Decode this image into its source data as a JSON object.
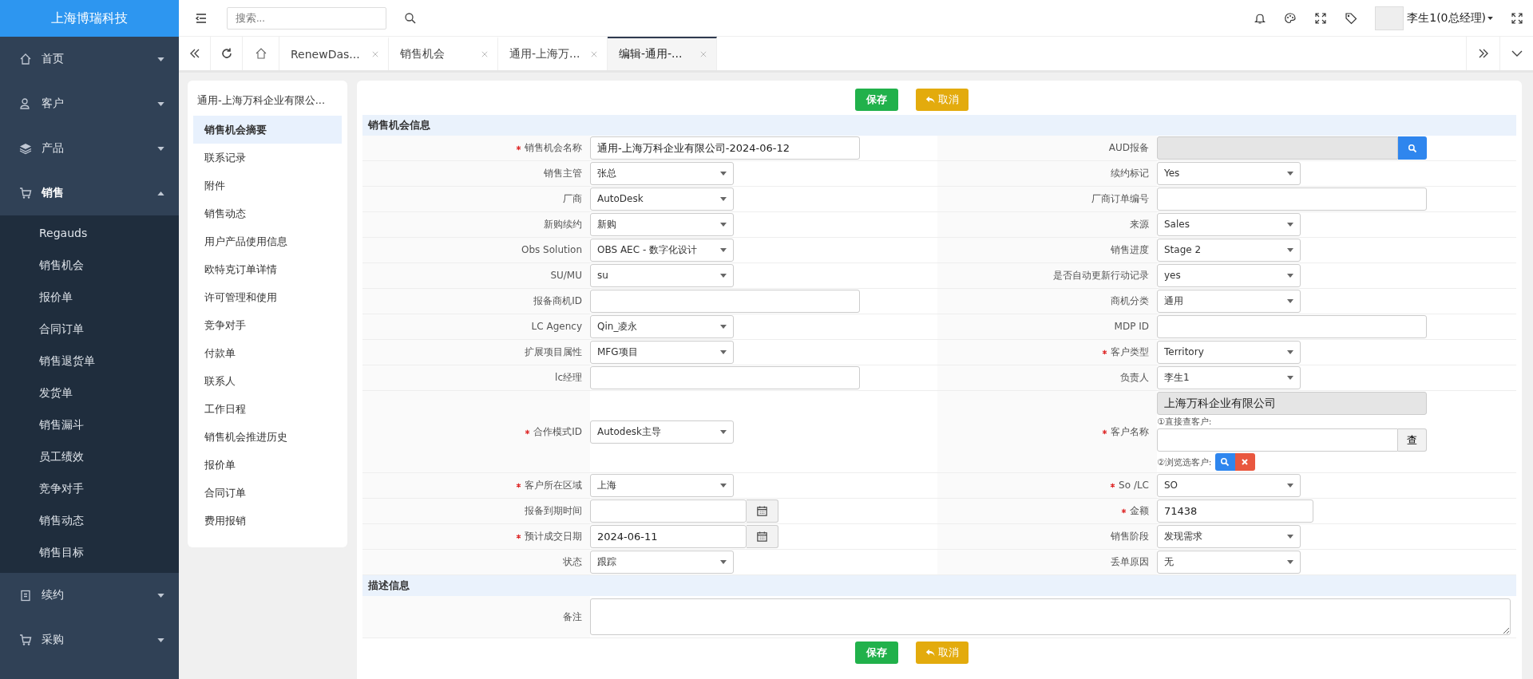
{
  "logo": "上海博瑞科技",
  "sidebar": {
    "items": [
      {
        "label": "首页",
        "expanded": false
      },
      {
        "label": "客户",
        "expanded": false
      },
      {
        "label": "产品",
        "expanded": false
      },
      {
        "label": "销售",
        "expanded": true,
        "children": [
          {
            "label": "Regauds"
          },
          {
            "label": "销售机会"
          },
          {
            "label": "报价单"
          },
          {
            "label": "合同订单"
          },
          {
            "label": "销售退货单"
          },
          {
            "label": "发货单"
          },
          {
            "label": "销售漏斗"
          },
          {
            "label": "员工绩效"
          },
          {
            "label": "竞争对手"
          },
          {
            "label": "销售动态"
          },
          {
            "label": "销售目标"
          }
        ]
      },
      {
        "label": "续约",
        "expanded": false
      },
      {
        "label": "采购",
        "expanded": false
      }
    ]
  },
  "topbar": {
    "search": {
      "placeholder": "搜索..."
    },
    "user": "李生1(0总经理)"
  },
  "tabs": [
    {
      "label": "RenewDas...",
      "selected": false
    },
    {
      "label": "销售机会",
      "selected": false
    },
    {
      "label": "通用-上海万...",
      "selected": false
    },
    {
      "label": "编辑-通用-...",
      "selected": true
    }
  ],
  "record_menu": {
    "title": "通用-上海万科企业有限公...",
    "items": [
      {
        "label": "销售机会摘要",
        "selected": true
      },
      {
        "label": "联系记录",
        "selected": false
      },
      {
        "label": "附件",
        "selected": false
      },
      {
        "label": "销售动态",
        "selected": false
      },
      {
        "label": "用户产品使用信息",
        "selected": false
      },
      {
        "label": "欧特克订单详情",
        "selected": false
      },
      {
        "label": "许可管理和使用",
        "selected": false
      },
      {
        "label": "竞争对手",
        "selected": false
      },
      {
        "label": "付款单",
        "selected": false
      },
      {
        "label": "联系人",
        "selected": false
      },
      {
        "label": "工作日程",
        "selected": false
      },
      {
        "label": "销售机会推进历史",
        "selected": false
      },
      {
        "label": "报价单",
        "selected": false
      },
      {
        "label": "合同订单",
        "selected": false
      },
      {
        "label": "费用报销",
        "selected": false
      }
    ]
  },
  "buttons_top": {
    "save": "保存",
    "cancel": "取消"
  },
  "buttons_bottom": {
    "save": "保存",
    "cancel": "取消"
  },
  "sections": [
    {
      "title": "销售机会信息",
      "rows": [
        [
          {
            "label": "销售机会名称",
            "required": true,
            "kind": "text",
            "value": "通用-上海万科企业有限公司-2024-06-12"
          },
          {
            "label": "AUD报备",
            "required": false,
            "kind": "lookup"
          }
        ],
        [
          {
            "label": "销售主管",
            "required": false,
            "kind": "select",
            "value": "张总"
          },
          {
            "label": "续约标记",
            "required": false,
            "kind": "select",
            "value": "Yes"
          }
        ],
        [
          {
            "label": "厂商",
            "required": false,
            "kind": "select",
            "value": "AutoDesk"
          },
          {
            "label": "厂商订单编号",
            "required": false,
            "kind": "text"
          }
        ],
        [
          {
            "label": "新购续约",
            "required": false,
            "kind": "select",
            "value": "新购"
          },
          {
            "label": "来源",
            "required": false,
            "kind": "select",
            "value": "Sales"
          }
        ],
        [
          {
            "label": "Obs Solution",
            "required": false,
            "kind": "select",
            "value": "OBS AEC - 数字化设计"
          },
          {
            "label": "销售进度",
            "required": false,
            "kind": "select",
            "value": "Stage 2"
          }
        ],
        [
          {
            "label": "SU/MU",
            "required": false,
            "kind": "select",
            "value": "su"
          },
          {
            "label": "是否自动更新行动记录",
            "required": false,
            "kind": "select",
            "value": "yes"
          }
        ],
        [
          {
            "label": "报备商机ID",
            "required": false,
            "kind": "text"
          },
          {
            "label": "商机分类",
            "required": false,
            "kind": "select",
            "value": "通用"
          }
        ],
        [
          {
            "label": "LC Agency",
            "required": false,
            "kind": "select",
            "value": "Qin_凌永"
          },
          {
            "label": "MDP ID",
            "required": false,
            "kind": "text"
          }
        ],
        [
          {
            "label": "扩展项目属性",
            "required": false,
            "kind": "select",
            "value": "MFG项目"
          },
          {
            "label": "客户类型",
            "required": true,
            "kind": "select",
            "value": "Territory"
          }
        ],
        [
          {
            "label": "lc经理",
            "required": false,
            "kind": "text"
          },
          {
            "label": "负责人",
            "required": false,
            "kind": "select",
            "value": "李生1"
          }
        ],
        [
          {
            "label": "合作模式ID",
            "required": true,
            "kind": "select",
            "value": "Autodesk主导"
          },
          {
            "label": "客户名称",
            "required": true,
            "kind": "customer",
            "value": "上海万科企业有限公司",
            "direct_label": "①直接查客户:",
            "query_button": "查",
            "browse_label": "②浏览选客户:"
          }
        ],
        [
          {
            "label": "客户所在区域",
            "required": true,
            "kind": "select",
            "value": "上海"
          },
          {
            "label": "So /LC",
            "required": true,
            "kind": "select",
            "value": "SO"
          }
        ],
        [
          {
            "label": "报备到期时间",
            "required": false,
            "kind": "date"
          },
          {
            "label": "金额",
            "required": true,
            "kind": "short",
            "value": "71438"
          }
        ],
        [
          {
            "label": "预计成交日期",
            "required": true,
            "kind": "date",
            "value": "2024-06-11"
          },
          {
            "label": "销售阶段",
            "required": false,
            "kind": "select",
            "value": "发现需求"
          }
        ],
        [
          {
            "label": "状态",
            "required": false,
            "kind": "select",
            "value": "跟踪"
          },
          {
            "label": "丢单原因",
            "required": false,
            "kind": "select",
            "value": "无"
          }
        ]
      ]
    },
    {
      "title": "描述信息",
      "rows": [
        [
          {
            "label": "备注",
            "required": false,
            "kind": "textarea"
          }
        ]
      ]
    }
  ]
}
